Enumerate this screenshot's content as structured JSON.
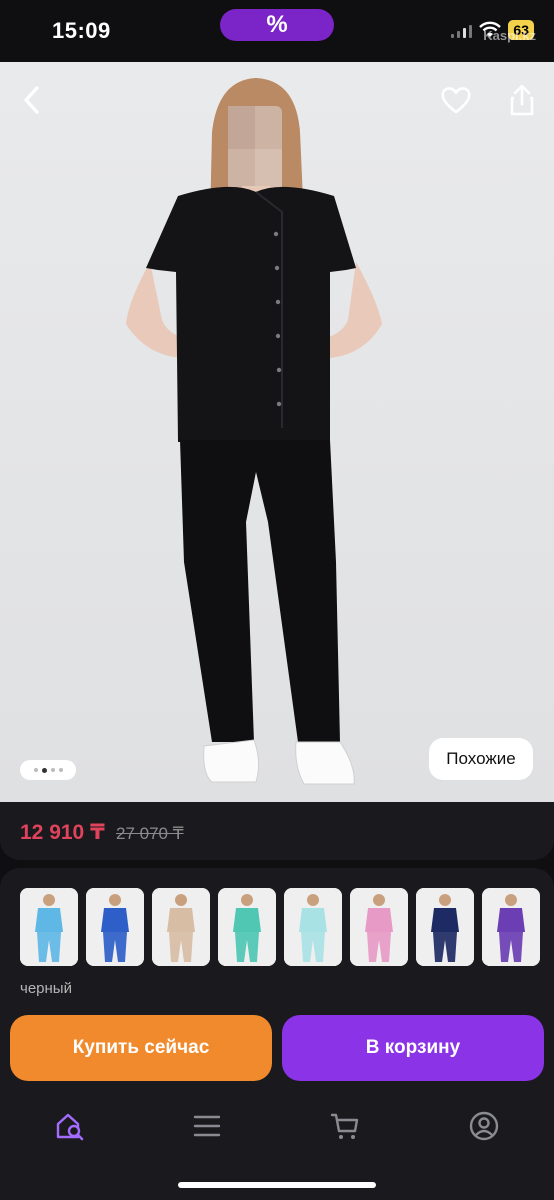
{
  "status_bar": {
    "time": "15:09",
    "island_label": "%",
    "battery": "63",
    "watermark": "Kaspi.kz"
  },
  "product": {
    "price": "12 910 ₸",
    "old_price": "27 070 ₸",
    "image_pager": {
      "count": 4,
      "active": 2
    },
    "similar_label": "Похожие"
  },
  "variants": {
    "thumbnails": [
      {
        "color": "#5fb7e6"
      },
      {
        "color": "#2e5fc9"
      },
      {
        "color": "#d8bda5"
      },
      {
        "color": "#4fc7b3"
      },
      {
        "color": "#a9e2e4"
      },
      {
        "color": "#e79ac6"
      },
      {
        "color": "#1e2a63"
      },
      {
        "color": "#6b3fb3"
      }
    ],
    "selected_color": "черный"
  },
  "actions": {
    "buy_now": "Купить сейчас",
    "add_to_cart": "В корзину"
  },
  "nav": [
    "search-home-icon",
    "menu-icon",
    "cart-icon",
    "profile-icon"
  ],
  "colors": {
    "accent_purple": "#8b33e6",
    "accent_orange": "#f08a2c",
    "price_red": "#e0435c"
  }
}
